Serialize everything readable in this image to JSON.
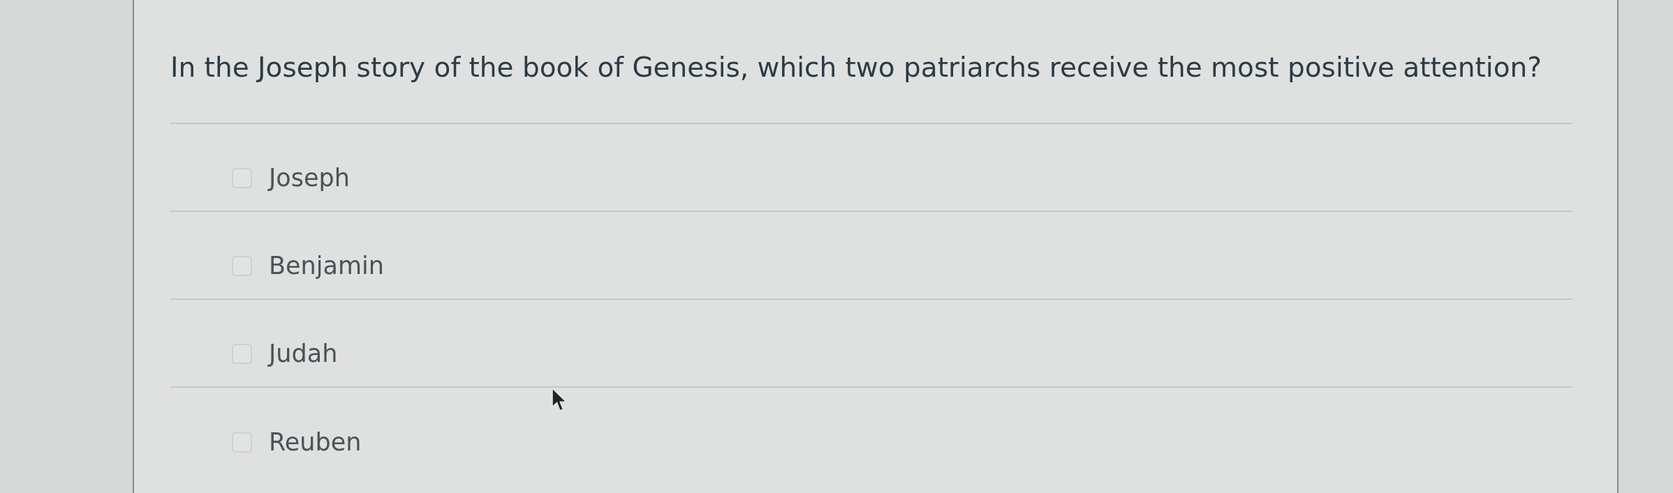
{
  "question": {
    "text": "In the Joseph story of the book of Genesis, which two patriarchs receive the most positive attention?"
  },
  "options": [
    {
      "label": "Joseph",
      "checked": false
    },
    {
      "label": "Benjamin",
      "checked": false
    },
    {
      "label": "Judah",
      "checked": false
    },
    {
      "label": "Reuben",
      "checked": false
    }
  ]
}
